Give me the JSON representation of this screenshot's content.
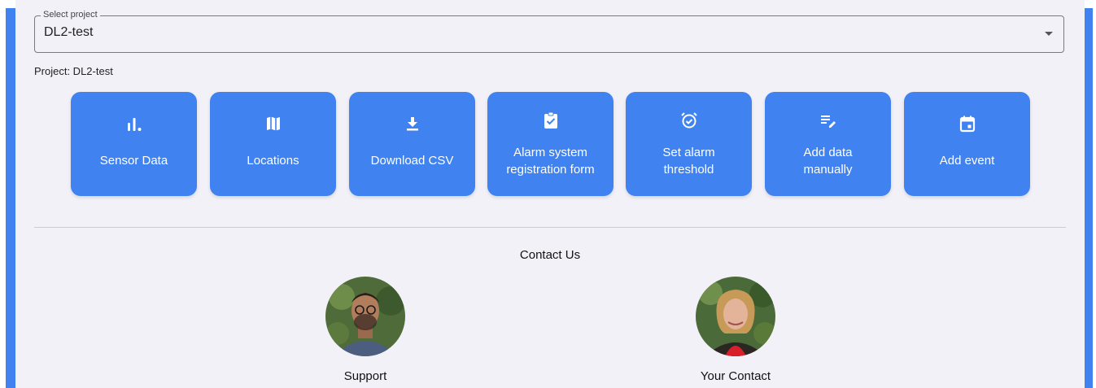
{
  "select": {
    "legend": "Select project",
    "value": "DL2-test"
  },
  "project_line": "Project: DL2-test",
  "tiles": [
    {
      "line1": "Sensor Data",
      "line2": "",
      "icon": "bar-chart-icon"
    },
    {
      "line1": "Locations",
      "line2": "",
      "icon": "map-icon"
    },
    {
      "line1": "Download CSV",
      "line2": "",
      "icon": "download-icon"
    },
    {
      "line1": "Alarm system",
      "line2": "registration form",
      "icon": "clipboard-check-icon"
    },
    {
      "line1": "Set alarm",
      "line2": "threshold",
      "icon": "alarm-icon"
    },
    {
      "line1": "Add data",
      "line2": "manually",
      "icon": "edit-note-icon"
    },
    {
      "line1": "Add event",
      "line2": "",
      "icon": "calendar-icon"
    }
  ],
  "contact": {
    "title": "Contact Us",
    "people": [
      {
        "name": "Support"
      },
      {
        "name": "Your Contact"
      }
    ]
  },
  "colors": {
    "accent": "#3f82f0",
    "panel": "#f3f1f8"
  }
}
